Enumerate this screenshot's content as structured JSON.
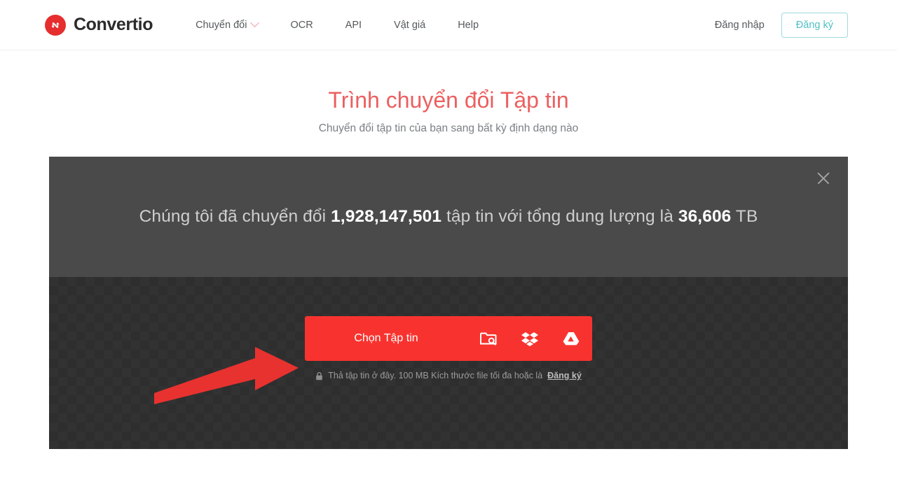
{
  "header": {
    "brand": {
      "name": "Convertio",
      "logo_icon": "convertio-logo-icon",
      "accent_color": "#e62e2e"
    },
    "nav": [
      {
        "label": "Chuyển đổi",
        "has_dropdown": true
      },
      {
        "label": "OCR",
        "has_dropdown": false
      },
      {
        "label": "API",
        "has_dropdown": false
      },
      {
        "label": "Vật giá",
        "has_dropdown": false
      },
      {
        "label": "Help",
        "has_dropdown": false
      }
    ],
    "login_label": "Đăng nhập",
    "signup_label": "Đăng ký",
    "signup_color": "#4fbfc4"
  },
  "hero": {
    "title": "Trình chuyển đổi Tập tin",
    "title_color": "#ec5f5f",
    "subtitle": "Chuyển đổi tập tin của bạn sang bất kỳ định dạng nào"
  },
  "stats": {
    "prefix": "Chúng tôi đã chuyển đổi",
    "files_count": "1,928,147,501",
    "middle": "tập tin với tổng dung lượng là",
    "total_size": "36,606",
    "size_unit": "TB",
    "close_icon": "close-icon",
    "background_color": "#4a4a4a"
  },
  "dropzone": {
    "choose_label": "Chọn Tập tin",
    "button_color": "#f8332f",
    "sources": [
      {
        "name": "folder-search-icon"
      },
      {
        "name": "dropbox-icon"
      },
      {
        "name": "google-drive-icon"
      }
    ],
    "hint_lock_icon": "lock-icon",
    "hint_text": "Thả tập tin ở đây. 100 MB Kích thước file tối đa hoặc là",
    "hint_link": "Đăng ký",
    "background_color": "#323232"
  },
  "annotation": {
    "arrow_icon": "red-arrow-icon",
    "arrow_color": "#e8322f"
  }
}
